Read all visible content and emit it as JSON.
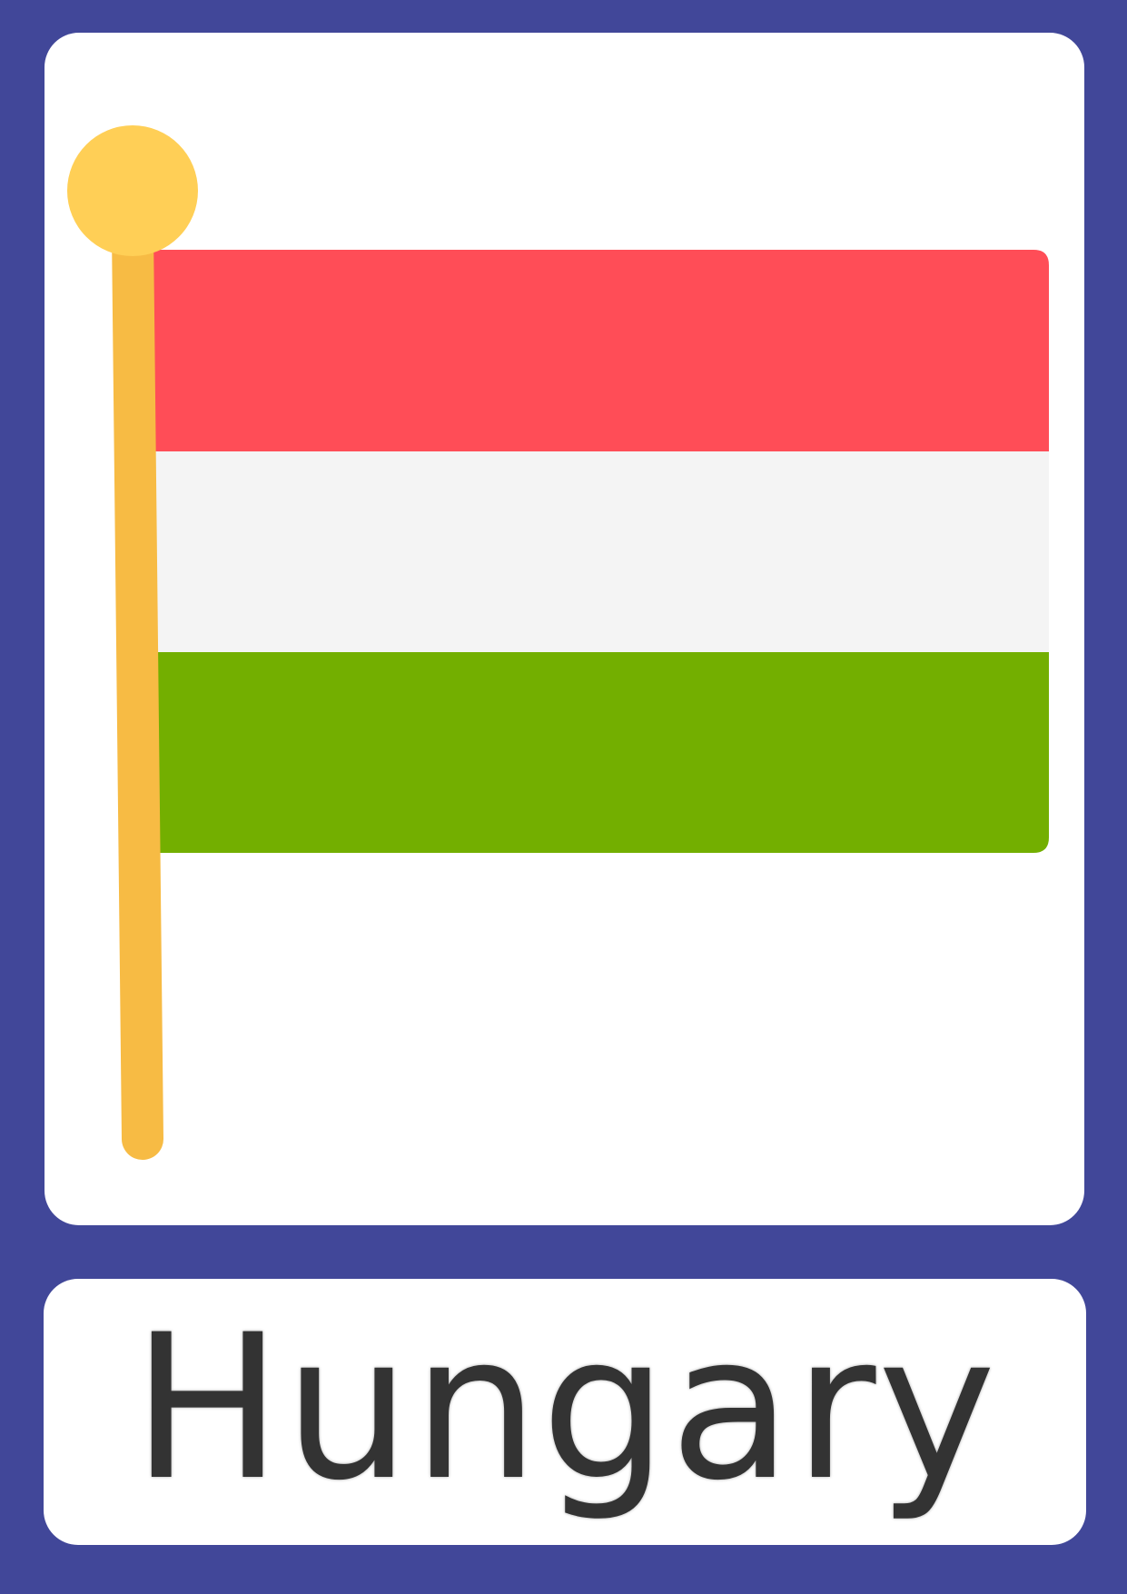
{
  "card": {
    "country_name": "Hungary",
    "colors": {
      "background": "#414799",
      "panel": "#ffffff",
      "flag_red": "#ff4d57",
      "flag_white": "#f4f4f4",
      "flag_green": "#73af00",
      "pole": "#f7bb44",
      "pole_finial": "#ffcf56",
      "text": "#333333"
    },
    "icons": [
      "flag-icon",
      "flagpole-icon"
    ]
  }
}
